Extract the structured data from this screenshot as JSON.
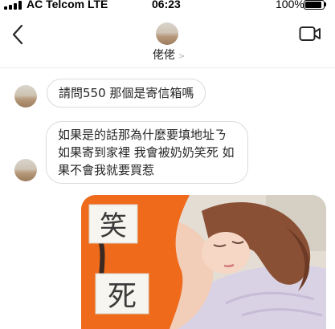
{
  "status_bar": {
    "carrier": "AC Telcom LTE",
    "time": "06:23",
    "battery_percent": "100%",
    "battery_level": 1.0
  },
  "header": {
    "contact_name": "佬佬",
    "chevron": ">"
  },
  "messages": [
    {
      "text": "請問550 那個是寄信箱嗎"
    },
    {
      "lines": [
        "如果是的話那為什麼要填地址ㄋ",
        "如果寄到家裡 我會被奶奶笑死 如",
        "果不會我就要買惹"
      ]
    }
  ],
  "photo": {
    "note_top": "笑",
    "note_bottom": "死"
  },
  "icons": {
    "back": "chevron-left-icon",
    "video": "video-camera-icon",
    "signal": "signal-bars-icon",
    "battery": "battery-icon"
  }
}
